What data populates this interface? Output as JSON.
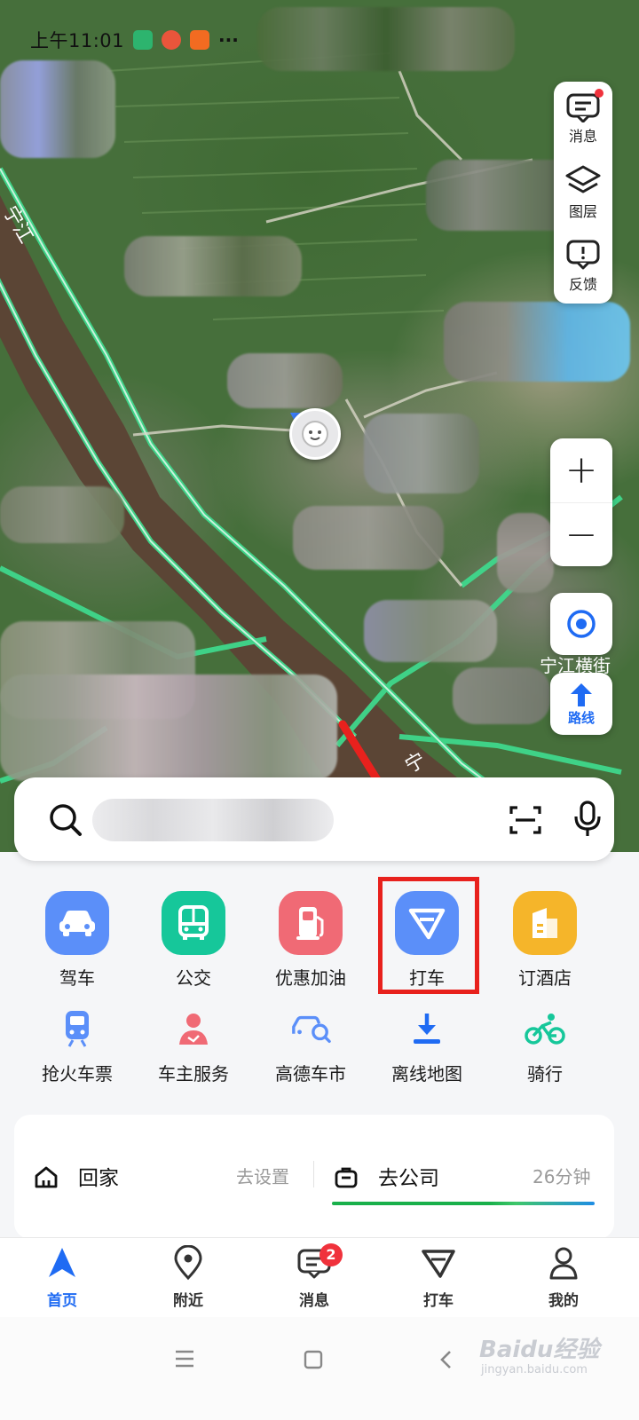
{
  "status_bar": {
    "time": "上午11:01",
    "more": "···"
  },
  "map": {
    "river_labels": [
      "宁江",
      "宁",
      "宁江"
    ],
    "road_label": "宁江横街",
    "side_panel": [
      {
        "label": "消息",
        "icon": "message-icon",
        "has_dot": true
      },
      {
        "label": "图层",
        "icon": "layers-icon"
      },
      {
        "label": "反馈",
        "icon": "feedback-icon"
      }
    ],
    "zoom_in": "+",
    "zoom_out": "−",
    "route_label": "路线"
  },
  "search": {
    "placeholder": ""
  },
  "quick_actions": [
    {
      "label": "驾车",
      "icon": "car-icon",
      "color": "#5b8ff9"
    },
    {
      "label": "公交",
      "icon": "bus-icon",
      "color": "#16c79a"
    },
    {
      "label": "优惠加油",
      "icon": "gas-station-icon",
      "color": "#f06a75"
    },
    {
      "label": "打车",
      "icon": "taxi-icon",
      "color": "#5b8ff9"
    },
    {
      "label": "订酒店",
      "icon": "hotel-icon",
      "color": "#f5b52a"
    }
  ],
  "secondary_actions": [
    {
      "label": "抢火车票",
      "icon": "train-icon"
    },
    {
      "label": "车主服务",
      "icon": "driver-service-icon"
    },
    {
      "label": "高德车市",
      "icon": "car-market-icon"
    },
    {
      "label": "离线地图",
      "icon": "download-icon"
    },
    {
      "label": "骑行",
      "icon": "bike-icon"
    }
  ],
  "shortcuts": {
    "home_label": "回家",
    "home_action": "去设置",
    "work_label": "去公司",
    "work_time": "26分钟"
  },
  "tabs": [
    {
      "label": "首页",
      "icon": "home-nav-icon",
      "active": true
    },
    {
      "label": "附近",
      "icon": "nearby-icon"
    },
    {
      "label": "消息",
      "icon": "message-tab-icon",
      "badge": "2"
    },
    {
      "label": "打车",
      "icon": "taxi-tab-icon"
    },
    {
      "label": "我的",
      "icon": "profile-icon"
    }
  ],
  "watermark": {
    "main": "Baidu经验",
    "sub": "jingyan.baidu.com"
  },
  "colors": {
    "accent": "#1f6bf3",
    "highlight_box": "#e8211d",
    "badge": "#f0323c"
  }
}
